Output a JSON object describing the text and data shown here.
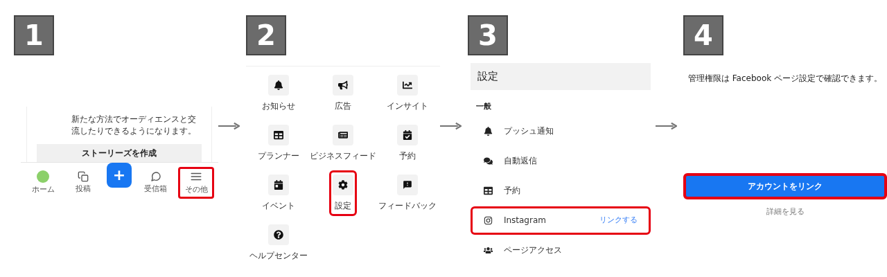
{
  "steps": [
    {
      "number": "1",
      "card_lines": [
        "新たな方法でオーディエンスと交",
        "流したりできるようになります。"
      ],
      "card_button": "ストーリーズを作成",
      "fab": "+",
      "nav": [
        {
          "label": "ホーム",
          "highlighted": false
        },
        {
          "label": "投稿",
          "highlighted": false
        },
        {
          "label": "受信箱",
          "highlighted": false
        },
        {
          "label": "その他",
          "highlighted": true
        }
      ]
    },
    {
      "number": "2",
      "menu": [
        {
          "label": "お知らせ",
          "highlighted": false
        },
        {
          "label": "広告",
          "highlighted": false
        },
        {
          "label": "インサイト",
          "highlighted": false
        },
        {
          "label": "プランナー",
          "highlighted": false
        },
        {
          "label": "ビジネスフィード",
          "highlighted": false
        },
        {
          "label": "予約",
          "highlighted": false
        },
        {
          "label": "イベント",
          "highlighted": false
        },
        {
          "label": "設定",
          "highlighted": true
        },
        {
          "label": "フィードバック",
          "highlighted": false
        },
        {
          "label": "ヘルプセンター",
          "highlighted": false
        }
      ]
    },
    {
      "number": "3",
      "title": "設定",
      "section": "一般",
      "rows": [
        {
          "label": "プッシュ通知",
          "highlighted": false
        },
        {
          "label": "自動返信",
          "highlighted": false
        },
        {
          "label": "予約",
          "highlighted": false
        },
        {
          "label": "Instagram",
          "action": "リンクする",
          "highlighted": true
        },
        {
          "label": "ページアクセス",
          "highlighted": false
        }
      ]
    },
    {
      "number": "4",
      "message": "管理権限は Facebook ページ設定で確認できます。",
      "button": {
        "label": "アカウントをリンク",
        "highlighted": true
      },
      "link": "詳細を見る"
    }
  ]
}
